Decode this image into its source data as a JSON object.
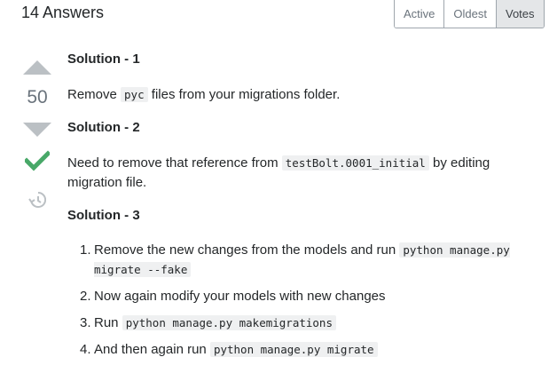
{
  "header": {
    "answers_count": "14 Answers",
    "sort_tabs": [
      {
        "label": "Active"
      },
      {
        "label": "Oldest"
      },
      {
        "label": "Votes"
      }
    ]
  },
  "vote": {
    "count": "50"
  },
  "icons": {
    "upvote": "arrow-up-icon",
    "downvote": "arrow-down-icon",
    "accepted": "checkmark-icon",
    "history": "history-icon"
  },
  "colors": {
    "accepted": "#48a868",
    "vote_arrow": "#bbc0c4",
    "code_bg": "#eff0f1"
  },
  "post": {
    "solution1": {
      "heading": "Solution - 1",
      "text_before": "Remove ",
      "code": "pyc",
      "text_after": " files from your migrations folder."
    },
    "solution2": {
      "heading": "Solution - 2",
      "text_before": "Need to remove that reference from ",
      "code": "testBolt.0001_initial",
      "text_after": " by editing migration file."
    },
    "solution3": {
      "heading": "Solution - 3",
      "steps": [
        {
          "num": "1.",
          "text": "Remove the new changes from the models and run ",
          "code": "python manage.py migrate --fake"
        },
        {
          "num": "2.",
          "text": "Now again modify your models with new changes",
          "code": ""
        },
        {
          "num": "3.",
          "text": "Run ",
          "code": "python manage.py makemigrations"
        },
        {
          "num": "4.",
          "text": "And then again run ",
          "code": "python manage.py migrate"
        }
      ]
    }
  }
}
